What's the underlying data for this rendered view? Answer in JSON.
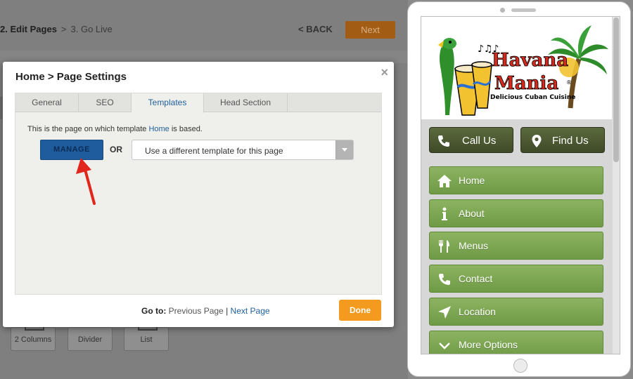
{
  "editor": {
    "steps": {
      "step2": "2. Edit Pages",
      "separator": ">",
      "step3": "3. Go Live"
    },
    "back_label": "< BACK",
    "next_label": "Next",
    "widgets": [
      {
        "label": "2 Columns"
      },
      {
        "label": "Divider"
      },
      {
        "label": "List"
      }
    ]
  },
  "modal": {
    "title": "Home > Page Settings",
    "close_glyph": "×",
    "tabs": [
      {
        "label": "General",
        "active": false
      },
      {
        "label": "SEO",
        "active": false
      },
      {
        "label": "Templates",
        "active": true
      },
      {
        "label": "Head Section",
        "active": false
      }
    ],
    "info_prefix": "This is the page on which template ",
    "info_link": "Home",
    "info_suffix": " is based.",
    "manage_label": "MANAGE",
    "or_label": "OR",
    "template_select_value": "Use a different template for this page",
    "goto_label": "Go to:",
    "prev_page_label": "Previous Page",
    "goto_separator": "|",
    "next_page_label": "Next Page",
    "done_label": "Done"
  },
  "phone": {
    "logo": {
      "line1": "Havana",
      "line2": "Mania",
      "registered": "®",
      "tagline": "Delicious Cuban Cuisine"
    },
    "call_label": "Call Us",
    "find_label": "Find Us",
    "nav_items": [
      {
        "label": "Home",
        "icon": "home-icon"
      },
      {
        "label": "About",
        "icon": "info-icon"
      },
      {
        "label": "Menus",
        "icon": "fork-knife-icon"
      },
      {
        "label": "Contact",
        "icon": "phone-icon"
      },
      {
        "label": "Location",
        "icon": "location-arrow-icon"
      },
      {
        "label": "More Options",
        "icon": "chevron-down-icon"
      }
    ]
  },
  "colors": {
    "manage_blue": "#1e5c9e",
    "done_orange": "#f39a1f",
    "nav_green": "#7ea853",
    "action_olive": "#4c5731",
    "link_blue": "#1f5f9a",
    "arrow_red": "#e2261c"
  }
}
